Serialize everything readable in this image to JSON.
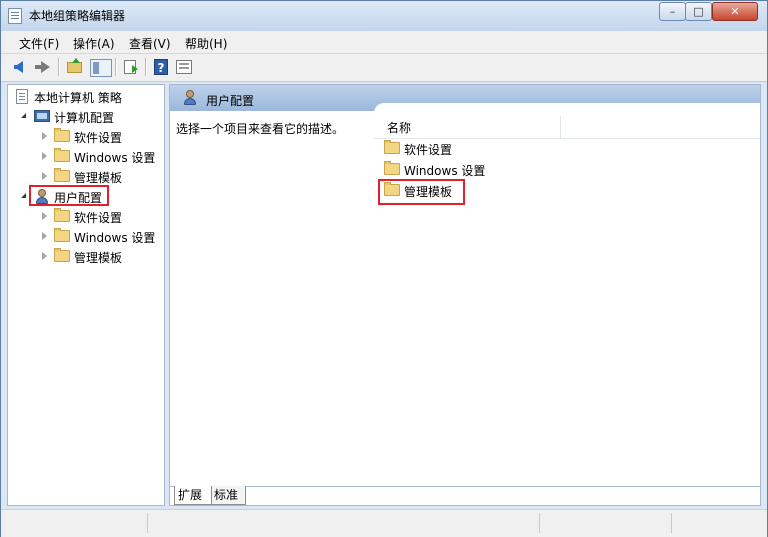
{
  "window": {
    "title": "本地组策略编辑器",
    "controls": {
      "minimize": "–",
      "maximize": "□",
      "close": "✕"
    }
  },
  "menu": [
    "文件(F)",
    "操作(A)",
    "查看(V)",
    "帮助(H)"
  ],
  "toolbar": {
    "icons": [
      "back-arrow-icon",
      "forward-arrow-icon",
      "up-folder-icon",
      "show-hide-tree-icon",
      "export-list-icon",
      "help-icon",
      "properties-icon"
    ],
    "help_glyph": "?"
  },
  "tree": {
    "root": "本地计算机 策略",
    "computer": {
      "label": "计算机配置",
      "children": [
        "软件设置",
        "Windows 设置",
        "管理模板"
      ]
    },
    "user": {
      "label": "用户配置",
      "children": [
        "软件设置",
        "Windows 设置",
        "管理模板"
      ]
    }
  },
  "right": {
    "header": "用户配置",
    "description": "选择一个项目来查看它的描述。",
    "column_name": "名称",
    "items": [
      "软件设置",
      "Windows 设置",
      "管理模板"
    ]
  },
  "tabs": [
    "扩展",
    "标准"
  ],
  "colors": {
    "highlight": "#e0202c",
    "header": "#9cb8da"
  }
}
